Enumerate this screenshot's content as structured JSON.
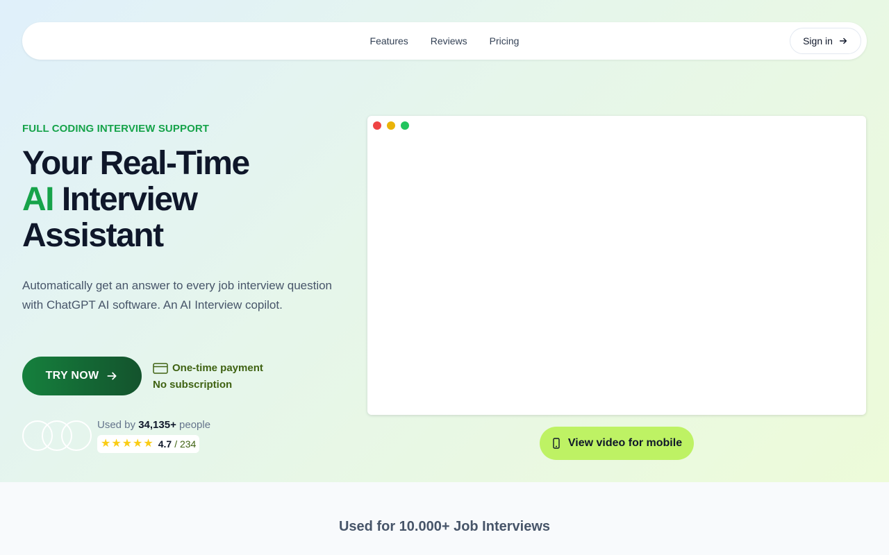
{
  "nav": {
    "links": [
      "Features",
      "Reviews",
      "Pricing"
    ],
    "signin_label": "Sign in"
  },
  "hero": {
    "eyebrow": "FULL CODING INTERVIEW SUPPORT",
    "headline_line1": "Your Real-Time",
    "headline_accent": "AI",
    "headline_line2_rest": " Interview",
    "headline_line3": "Assistant",
    "subtext": "Automatically get an answer to every job interview question with ChatGPT AI software. An AI Interview copilot.",
    "cta_label": "TRY NOW",
    "payment_line1": "One-time payment",
    "payment_line2": "No subscription"
  },
  "social_proof": {
    "used_by_prefix": "Used by",
    "used_by_count": "34,135+",
    "used_by_suffix": "people",
    "rating": "4.7",
    "rating_count": "/ 234",
    "stars": 5
  },
  "demo": {
    "mobile_video_label": "View video for mobile"
  },
  "section": {
    "title": "Used for 10.000+ Job Interviews"
  },
  "colors": {
    "accent_green": "#16a34a",
    "cta_dark": "#14532d",
    "lime": "#bef264",
    "star": "#facc15"
  },
  "icons": [
    "arrow-right-icon",
    "credit-card-icon",
    "star-icon",
    "smartphone-icon"
  ]
}
